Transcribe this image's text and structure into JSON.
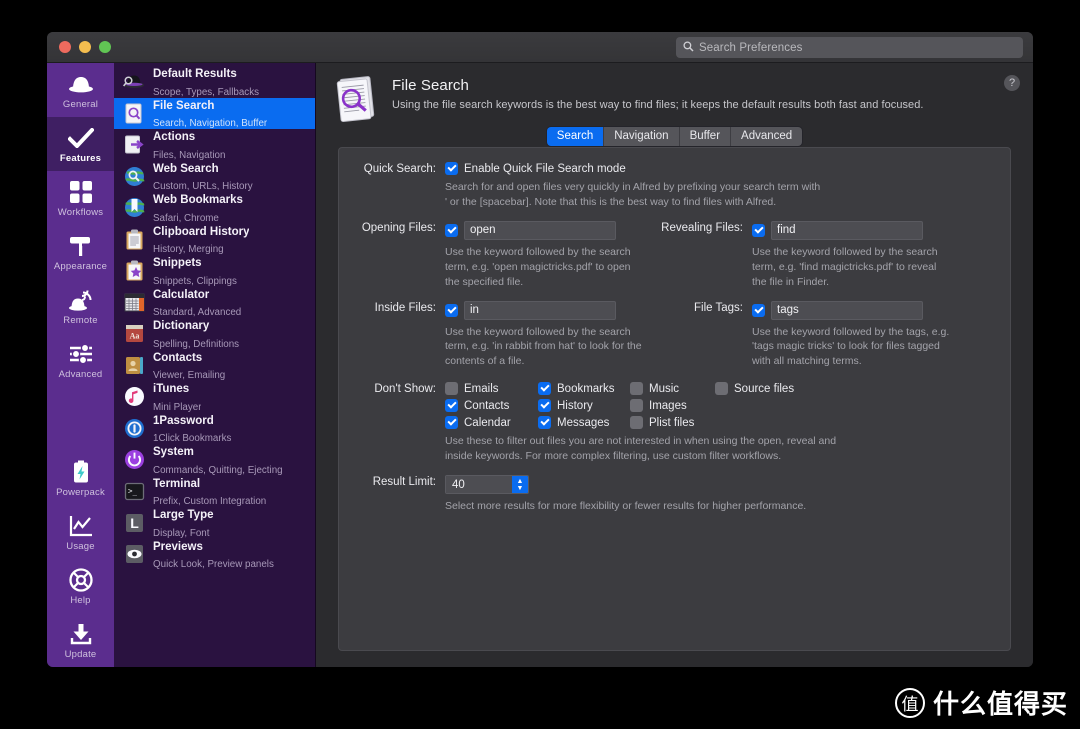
{
  "window": {
    "traffic_lights": [
      "close",
      "minimize",
      "zoom"
    ],
    "colors": {
      "close": "#ed6a5e",
      "minimize": "#f4bd4f",
      "zoom": "#61c554",
      "accent": "#0a6cf0",
      "rail": "#5b2d8e",
      "rail_active": "#3f1f63",
      "list_bg": "#2a1240",
      "panel": "#3c3c40"
    }
  },
  "search": {
    "placeholder": "Search Preferences",
    "value": "",
    "icon": "search-icon"
  },
  "rail": {
    "items": [
      {
        "label": "General",
        "icon": "hat-icon",
        "active": false
      },
      {
        "label": "Features",
        "icon": "checkmark-icon",
        "active": true
      },
      {
        "label": "Workflows",
        "icon": "grid-squares-icon",
        "active": false
      },
      {
        "label": "Appearance",
        "icon": "paint-roller-icon",
        "active": false
      },
      {
        "label": "Remote",
        "icon": "remote-waves-icon",
        "active": false
      },
      {
        "label": "Advanced",
        "icon": "sliders-icon",
        "active": false
      },
      {
        "label": "Powerpack",
        "icon": "battery-bolt-icon",
        "active": false
      },
      {
        "label": "Usage",
        "icon": "chart-line-icon",
        "active": false
      },
      {
        "label": "Help",
        "icon": "life-ring-icon",
        "active": false
      },
      {
        "label": "Update",
        "icon": "download-icon",
        "active": false
      }
    ]
  },
  "feature_list": {
    "items": [
      {
        "title": "Default Results",
        "subtitle": "Scope, Types, Fallbacks",
        "icon": "hat-magnifier-icon",
        "selected": false
      },
      {
        "title": "File Search",
        "subtitle": "Search, Navigation, Buffer",
        "icon": "document-magnifier-icon",
        "selected": true
      },
      {
        "title": "Actions",
        "subtitle": "Files, Navigation",
        "icon": "page-arrow-icon",
        "selected": false
      },
      {
        "title": "Web Search",
        "subtitle": "Custom, URLs, History",
        "icon": "globe-magnifier-icon",
        "selected": false
      },
      {
        "title": "Web Bookmarks",
        "subtitle": "Safari, Chrome",
        "icon": "globe-bookmark-icon",
        "selected": false
      },
      {
        "title": "Clipboard History",
        "subtitle": "History, Merging",
        "icon": "clipboard-icon",
        "selected": false
      },
      {
        "title": "Snippets",
        "subtitle": "Snippets, Clippings",
        "icon": "clipboard-star-icon",
        "selected": false
      },
      {
        "title": "Calculator",
        "subtitle": "Standard, Advanced",
        "icon": "calculator-icon",
        "selected": false
      },
      {
        "title": "Dictionary",
        "subtitle": "Spelling, Definitions",
        "icon": "dictionary-book-icon",
        "selected": false
      },
      {
        "title": "Contacts",
        "subtitle": "Viewer, Emailing",
        "icon": "address-book-icon",
        "selected": false
      },
      {
        "title": "iTunes",
        "subtitle": "Mini Player",
        "icon": "itunes-note-icon",
        "selected": false
      },
      {
        "title": "1Password",
        "subtitle": "1Click Bookmarks",
        "icon": "onepassword-icon",
        "selected": false
      },
      {
        "title": "System",
        "subtitle": "Commands, Quitting, Ejecting",
        "icon": "power-icon",
        "selected": false
      },
      {
        "title": "Terminal",
        "subtitle": "Prefix, Custom Integration",
        "icon": "terminal-icon",
        "selected": false
      },
      {
        "title": "Large Type",
        "subtitle": "Display, Font",
        "icon": "large-type-l-icon",
        "selected": false
      },
      {
        "title": "Previews",
        "subtitle": "Quick Look, Preview panels",
        "icon": "eye-icon",
        "selected": false
      }
    ]
  },
  "header": {
    "icon": "document-magnifier-large-icon",
    "title": "File Search",
    "subtitle": "Using the file search keywords is the best way to find files; it keeps the default results both fast and focused.",
    "help_label": "?"
  },
  "tabs": [
    {
      "label": "Search",
      "active": true
    },
    {
      "label": "Navigation",
      "active": false
    },
    {
      "label": "Buffer",
      "active": false
    },
    {
      "label": "Advanced",
      "active": false
    }
  ],
  "form": {
    "quick_search": {
      "label": "Quick Search:",
      "checkbox_label": "Enable Quick File Search mode",
      "checked": true,
      "hint_line1": "Search for and open files very quickly in Alfred by prefixing your search term with",
      "hint_line2": "' or the [spacebar]. Note that this is the best way to find files with Alfred."
    },
    "opening_files": {
      "label": "Opening Files:",
      "checked": true,
      "value": "open",
      "hint_line1": "Use the keyword followed by the search",
      "hint_line2": "term, e.g. 'open magictricks.pdf' to open",
      "hint_line3": "the specified file."
    },
    "revealing_files": {
      "label": "Revealing Files:",
      "checked": true,
      "value": "find",
      "hint_line1": "Use the keyword followed by the search",
      "hint_line2": "term, e.g. 'find magictricks.pdf' to reveal",
      "hint_line3": "the file in Finder."
    },
    "inside_files": {
      "label": "Inside Files:",
      "checked": true,
      "value": "in",
      "hint_line1": "Use the keyword followed by the search",
      "hint_line2": "term, e.g. 'in rabbit from hat' to look for the",
      "hint_line3": "contents of a file."
    },
    "file_tags": {
      "label": "File Tags:",
      "checked": true,
      "value": "tags",
      "hint_line1": "Use the keyword followed by the tags, e.g.",
      "hint_line2": "'tags magic tricks' to look for files tagged",
      "hint_line3": "with all matching terms."
    },
    "dont_show": {
      "label": "Don't Show:",
      "columns": [
        [
          {
            "label": "Emails",
            "checked": false
          },
          {
            "label": "Contacts",
            "checked": true
          },
          {
            "label": "Calendar",
            "checked": true
          }
        ],
        [
          {
            "label": "Bookmarks",
            "checked": true
          },
          {
            "label": "History",
            "checked": true
          },
          {
            "label": "Messages",
            "checked": true
          }
        ],
        [
          {
            "label": "Music",
            "checked": false
          },
          {
            "label": "Images",
            "checked": false
          },
          {
            "label": "Plist files",
            "checked": false
          }
        ],
        [
          {
            "label": "Source files",
            "checked": false
          }
        ]
      ],
      "hint_line1": "Use these to filter out files you are not interested in when using the open, reveal and",
      "hint_line2": "inside keywords. For more complex filtering, use custom filter workflows."
    },
    "result_limit": {
      "label": "Result Limit:",
      "value": "40",
      "hint": "Select more results for more flexibility or fewer results for higher performance."
    }
  },
  "watermark": {
    "badge": "值",
    "text": "什么值得买"
  }
}
